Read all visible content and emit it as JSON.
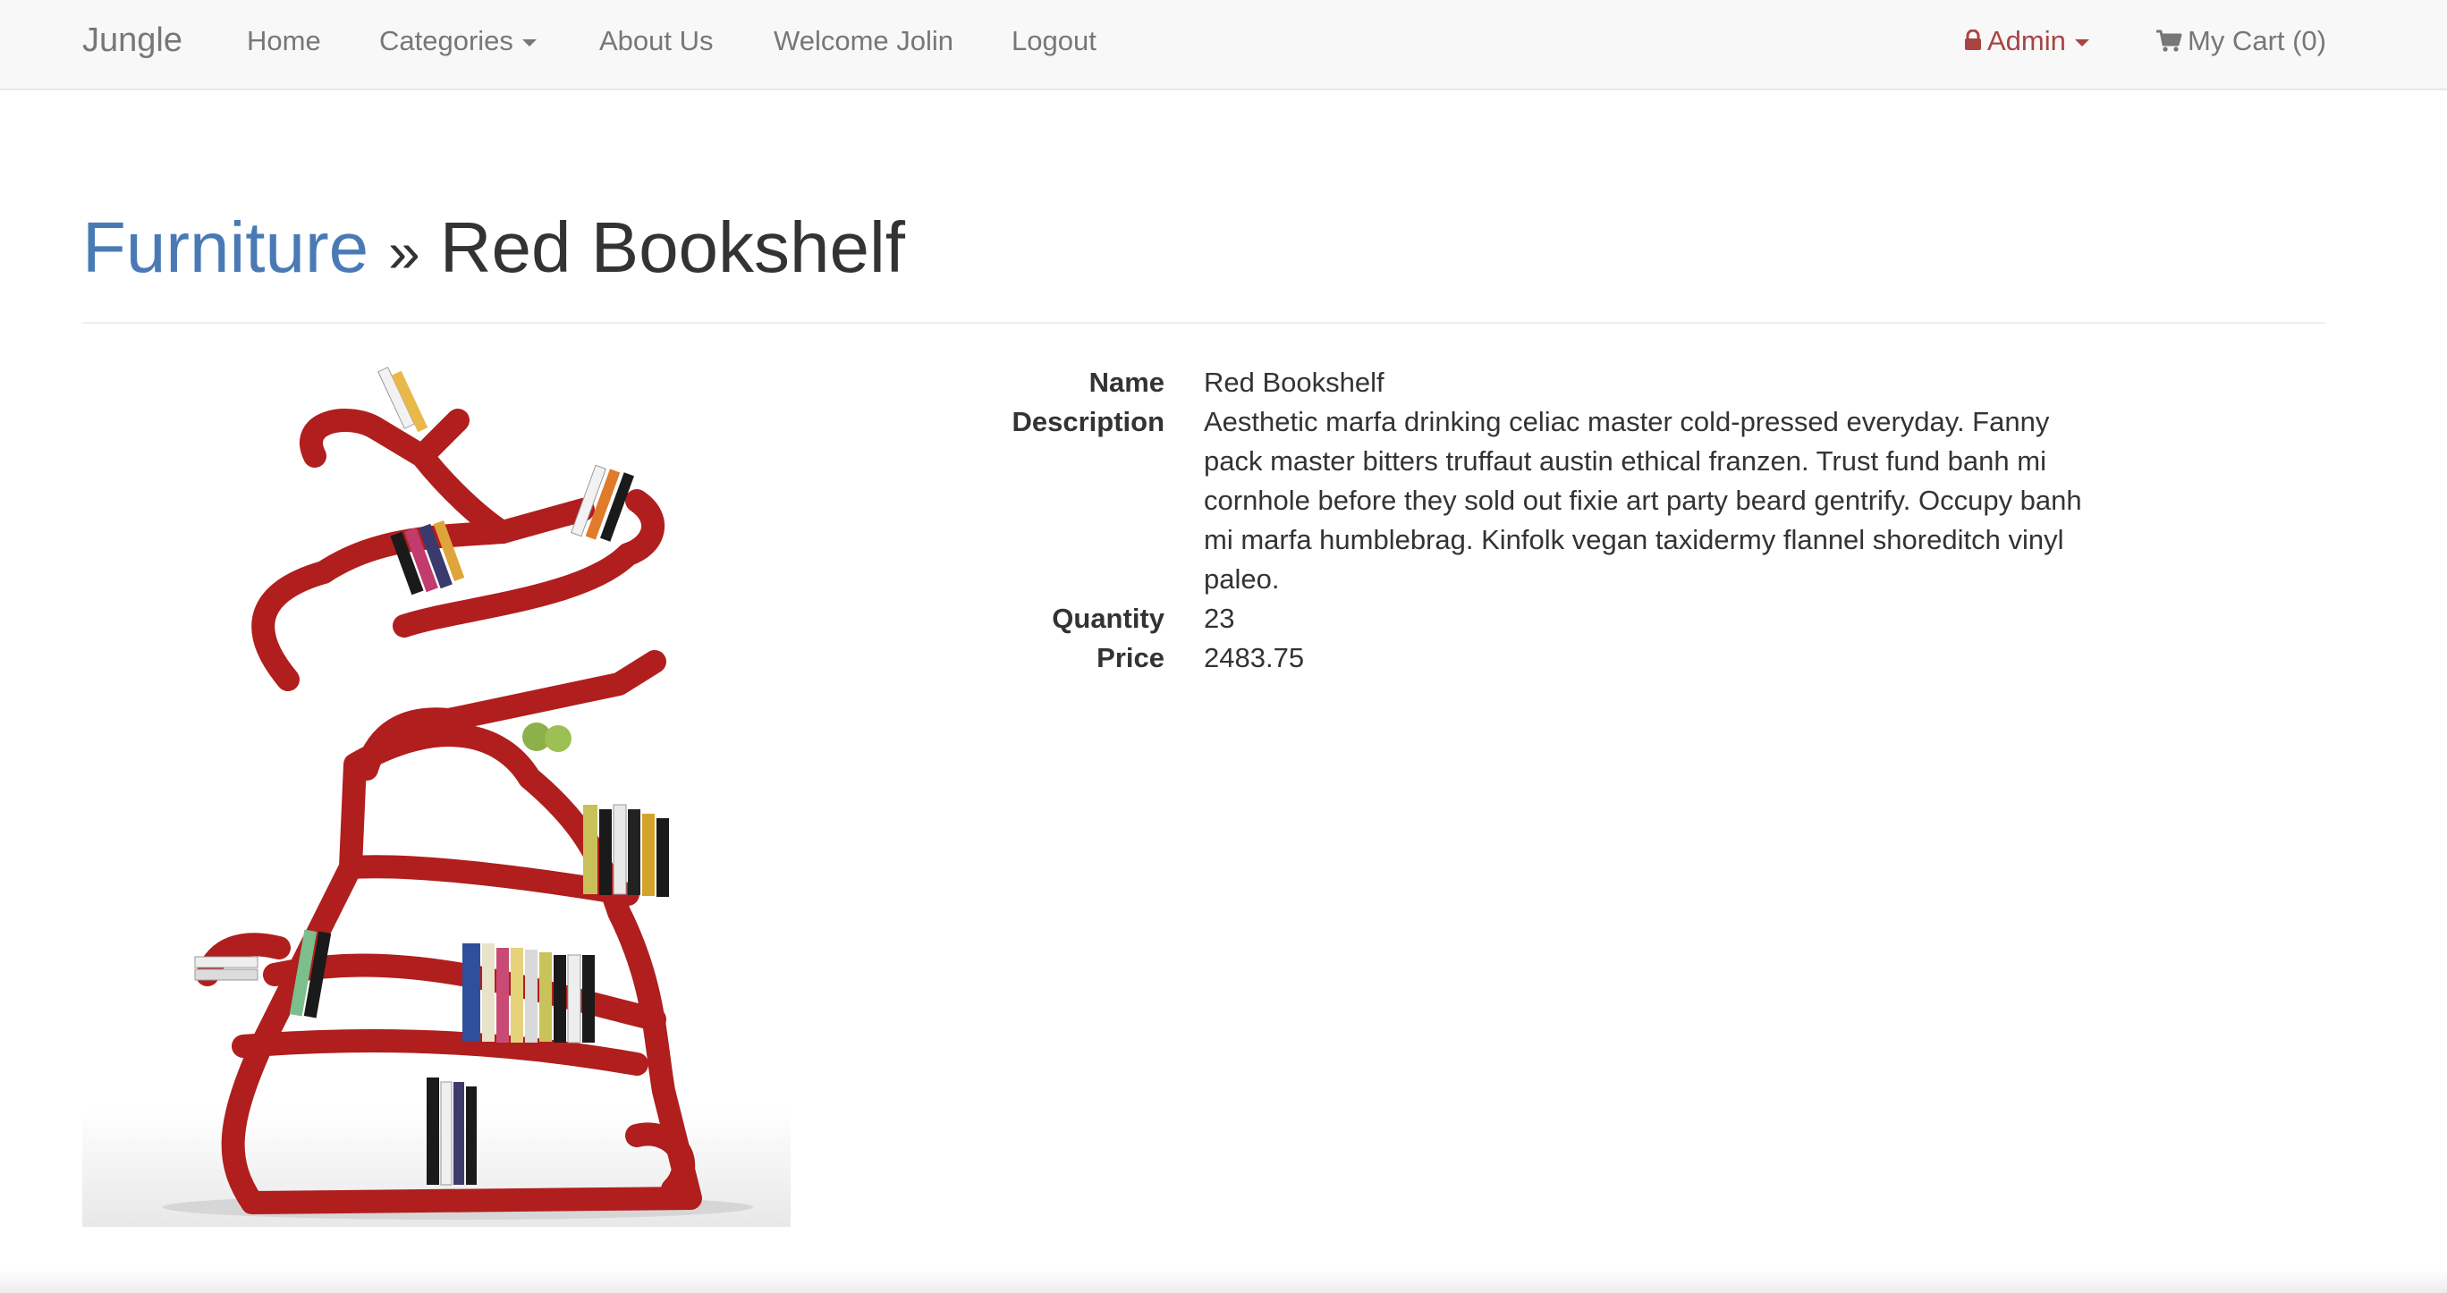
{
  "nav": {
    "brand": "Jungle",
    "home": "Home",
    "categories": "Categories",
    "about": "About Us",
    "welcome": "Welcome Jolin",
    "logout": "Logout",
    "admin": "Admin",
    "cart": "My Cart (0)",
    "admin_color": "#a94442"
  },
  "breadcrumb": {
    "category": "Furniture",
    "separator": "»",
    "product": "Red Bookshelf"
  },
  "product": {
    "image": "red-bookshelf-image",
    "labels": {
      "name": "Name",
      "description": "Description",
      "quantity": "Quantity",
      "price": "Price"
    },
    "name": "Red Bookshelf",
    "description": "Aesthetic marfa drinking celiac master cold-pressed everyday. Fanny pack master bitters truffaut austin ethical franzen. Trust fund banh mi cornhole before they sold out fixie art party beard gentrify. Occupy banh mi marfa humblebrag. Kinfolk vegan taxidermy flannel shoreditch vinyl paleo.",
    "quantity": "23",
    "price": "2483.75"
  },
  "colors": {
    "link": "#4a7ab5",
    "shelf_red": "#b01e1e"
  }
}
